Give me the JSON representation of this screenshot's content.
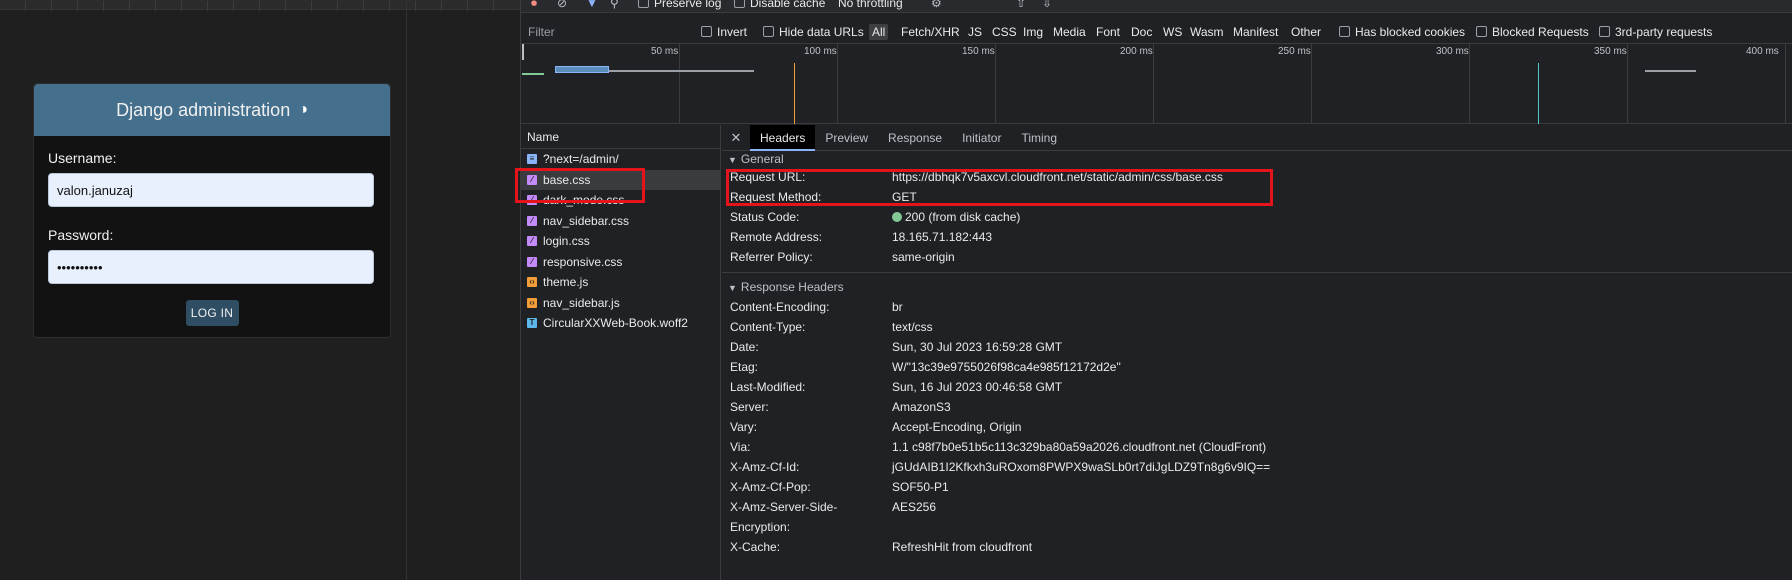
{
  "django": {
    "header_title": "Django administration",
    "theme_icon": "◑",
    "username_label": "Username:",
    "username_value": "valon.januzaj",
    "password_label": "Password:",
    "password_value": "••••••••••",
    "login_button": "LOG IN"
  },
  "toolbar": {
    "preserve_log": "Preserve log",
    "disable_cache": "Disable cache",
    "throttling": "No throttling"
  },
  "filterbar": {
    "placeholder": "Filter",
    "invert": "Invert",
    "hide_data_urls": "Hide data URLs",
    "types": [
      "All",
      "Fetch/XHR",
      "JS",
      "CSS",
      "Img",
      "Media",
      "Font",
      "Doc",
      "WS",
      "Wasm",
      "Manifest",
      "Other"
    ],
    "has_blocked_cookies": "Has blocked cookies",
    "blocked_requests": "Blocked Requests",
    "third_party": "3rd-party requests"
  },
  "timeline": {
    "ticks": [
      "50 ms",
      "100 ms",
      "150 ms",
      "200 ms",
      "250 ms",
      "300 ms",
      "350 ms",
      "400 ms"
    ]
  },
  "requests": {
    "header": "Name",
    "items": [
      {
        "name": "?next=/admin/",
        "type": "doc",
        "icon": "document-icon"
      },
      {
        "name": "base.css",
        "type": "css",
        "icon": "stylesheet-icon"
      },
      {
        "name": "dark_mode.css",
        "type": "css",
        "icon": "stylesheet-icon"
      },
      {
        "name": "nav_sidebar.css",
        "type": "css",
        "icon": "stylesheet-icon"
      },
      {
        "name": "login.css",
        "type": "css",
        "icon": "stylesheet-icon"
      },
      {
        "name": "responsive.css",
        "type": "css",
        "icon": "stylesheet-icon"
      },
      {
        "name": "theme.js",
        "type": "js",
        "icon": "script-icon"
      },
      {
        "name": "nav_sidebar.js",
        "type": "js",
        "icon": "script-icon"
      },
      {
        "name": "CircularXXWeb-Book.woff2",
        "type": "font",
        "icon": "font-icon"
      }
    ]
  },
  "detail": {
    "tabs": [
      "Headers",
      "Preview",
      "Response",
      "Initiator",
      "Timing"
    ],
    "general_title": "General",
    "general": [
      {
        "k": "Request URL:",
        "v": "https://dbhqk7v5axcvl.cloudfront.net/static/admin/css/base.css"
      },
      {
        "k": "Request Method:",
        "v": "GET"
      },
      {
        "k": "Status Code:",
        "v": "200 (from disk cache)"
      },
      {
        "k": "Remote Address:",
        "v": "18.165.71.182:443"
      },
      {
        "k": "Referrer Policy:",
        "v": "same-origin"
      }
    ],
    "response_title": "Response Headers",
    "response": [
      {
        "k": "Content-Encoding:",
        "v": "br"
      },
      {
        "k": "Content-Type:",
        "v": "text/css"
      },
      {
        "k": "Date:",
        "v": "Sun, 30 Jul 2023 16:59:28 GMT"
      },
      {
        "k": "Etag:",
        "v": "W/\"13c39e9755026f98ca4e985f12172d2e\""
      },
      {
        "k": "Last-Modified:",
        "v": "Sun, 16 Jul 2023 00:46:58 GMT"
      },
      {
        "k": "Server:",
        "v": "AmazonS3"
      },
      {
        "k": "Vary:",
        "v": "Accept-Encoding, Origin"
      },
      {
        "k": "Via:",
        "v": "1.1 c98f7b0e51b5c113c329ba80a59a2026.cloudfront.net (CloudFront)"
      },
      {
        "k": "X-Amz-Cf-Id:",
        "v": "jGUdAIB1I2Kfkxh3uROxom8PWPX9waSLb0rt7diJgLDZ9Tn8g6v9IQ=="
      },
      {
        "k": "X-Amz-Cf-Pop:",
        "v": "SOF50-P1"
      },
      {
        "k": "X-Amz-Server-Side-Encryption:",
        "k1": "X-Amz-Server-Side-",
        "k2": "Encryption:",
        "v": "AES256"
      },
      {
        "k": "X-Cache:",
        "v": "RefreshHit from cloudfront"
      }
    ]
  },
  "colors": {
    "highlight": "#e3141c",
    "django_header": "#44708e",
    "status_ok": "#81c995"
  }
}
